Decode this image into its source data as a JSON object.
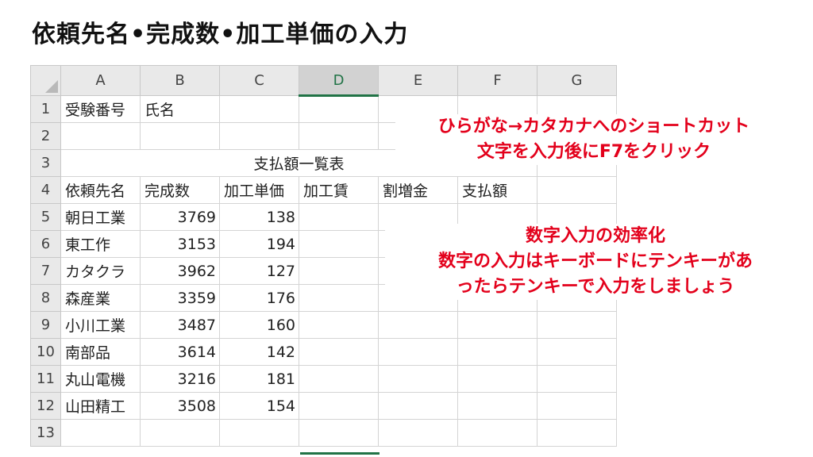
{
  "title": "依頼先名•完成数•加工単価の入力",
  "sheet": {
    "corner": "",
    "columns": [
      "A",
      "B",
      "C",
      "D",
      "E",
      "F",
      "G"
    ],
    "selected_column": "D",
    "rows": {
      "r1": {
        "num": "1",
        "A": "受験番号",
        "B": "氏名"
      },
      "r2": {
        "num": "2"
      },
      "r3": {
        "num": "3",
        "merged_title": "支払額一覧表"
      },
      "r4": {
        "num": "4",
        "A": "依頼先名",
        "B": "完成数",
        "C": "加工単価",
        "D": "加工賃",
        "E": "割増金",
        "F": "支払額"
      },
      "r5": {
        "num": "5",
        "A": "朝日工業",
        "B": "3769",
        "C": "138"
      },
      "r6": {
        "num": "6",
        "A": "東工作",
        "B": "3153",
        "C": "194"
      },
      "r7": {
        "num": "7",
        "A": "カタクラ",
        "B": "3962",
        "C": "127"
      },
      "r8": {
        "num": "8",
        "A": "森産業",
        "B": "3359",
        "C": "176"
      },
      "r9": {
        "num": "9",
        "A": "小川工業",
        "B": "3487",
        "C": "160"
      },
      "r10": {
        "num": "10",
        "A": "南部品",
        "B": "3614",
        "C": "142"
      },
      "r11": {
        "num": "11",
        "A": "丸山電機",
        "B": "3216",
        "C": "181"
      },
      "r12": {
        "num": "12",
        "A": "山田精工",
        "B": "3508",
        "C": "154"
      },
      "r13": {
        "num": "13"
      }
    }
  },
  "notes": {
    "katakana": {
      "line1": "ひらがな→カタカナへのショートカット",
      "line2": "文字を入力後にF7をクリック"
    },
    "tenkey": {
      "line1": "数字入力の効率化",
      "line2": "数字の入力はキーボードにテンキーがあ",
      "line3": "ったらテンキーで入力をしましょう"
    }
  },
  "colors": {
    "note_red": "#e3001b",
    "selection_green": "#217346",
    "header_gray": "#e9e9e9"
  }
}
